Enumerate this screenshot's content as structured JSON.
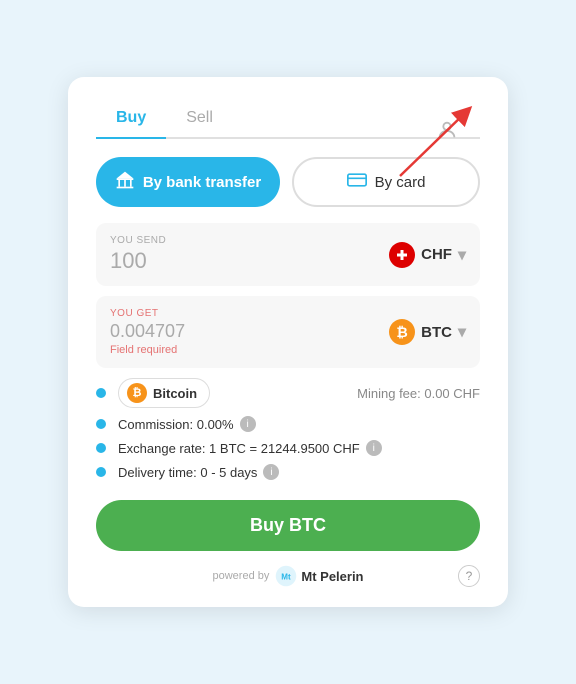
{
  "tabs": {
    "buy_label": "Buy",
    "sell_label": "Sell"
  },
  "payment": {
    "bank_label": "By bank transfer",
    "card_label": "By card"
  },
  "send": {
    "label": "YOU SEND",
    "value": "100",
    "currency": "CHF",
    "currency_symbol": "+"
  },
  "get": {
    "label": "YOU GET",
    "value": "0.004707",
    "currency": "BTC",
    "field_required": "Field required"
  },
  "timeline": {
    "coin_name": "Bitcoin",
    "mining_fee": "Mining fee: 0.00 CHF",
    "commission": "Commission: 0.00%",
    "exchange_rate": "Exchange rate: 1 BTC = 21244.9500 CHF",
    "delivery": "Delivery time: 0 - 5 days"
  },
  "buy_button": "Buy BTC",
  "footer": {
    "powered_by": "powered by",
    "brand": "Mt\nPelerin"
  },
  "icons": {
    "profile": "👤",
    "bank": "🏛",
    "card": "💳",
    "chf": "+",
    "btc": "₿",
    "info": "i",
    "help": "?"
  }
}
